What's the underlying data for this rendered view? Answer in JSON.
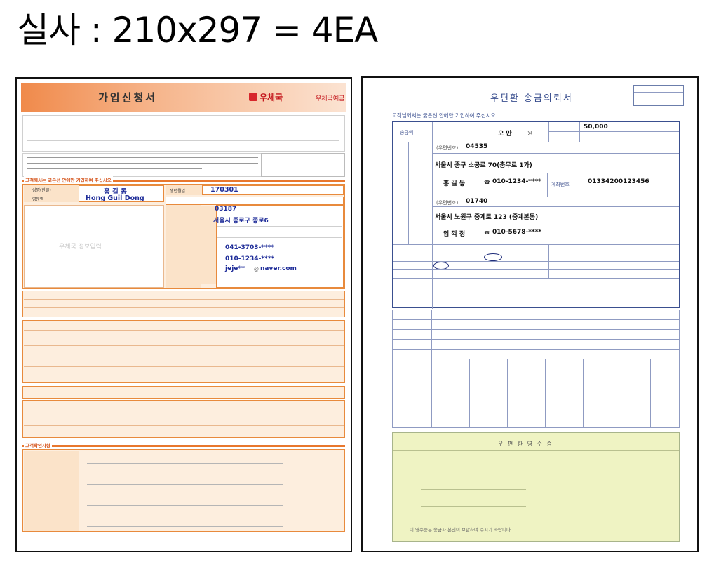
{
  "heading": "실사 : 210x297 = 4EA",
  "form1": {
    "title": "가입신청서",
    "brand": "우체국",
    "brand_sub": "우체국예금",
    "section_customer": "고객께서는 굵은선 안에만 기입하여 주십시오",
    "name_label": "성명(한글)",
    "name_en_label": "영문명",
    "name_ko": "홍 길 동",
    "name_en": "Hong Guil Dong",
    "birth_label": "생년월일",
    "birth": "170301",
    "zip": "03187",
    "address": "서울시 종로구 종로6",
    "phone_home": "041-3703-****",
    "phone_mobile": "010-1234-****",
    "email_id": "jeje**",
    "email_domain": "naver.com",
    "watermark": "우체국 정보입력",
    "section_confirm": "고객확인사항"
  },
  "form2": {
    "title": "우편환 송금의뢰서",
    "note": "고객님께서는 굵은선 안에만 기입하여 주십시오.",
    "amount_label": "송금액",
    "amount_name": "오 만",
    "amount_unit": "원",
    "amount_value": "50,000",
    "sender_zip_label": "(우편번호)",
    "sender_zip": "04535",
    "sender_addr": "서울시 중구 소공로 70(충무로 1가)",
    "sender_name": "홍 길 동",
    "sender_phone": "010-1234-****",
    "account_label": "계좌번호",
    "account": "01334200123456",
    "recv_zip": "01740",
    "recv_addr": "서울시 노원구 중계로 123 (중계본동)",
    "recv_name": "임 꺽 정",
    "recv_phone": "010-5678-****",
    "stamp_title": "우 편 환 영 수 증",
    "stamp_note": "이 영수증은 송금자 본인이 보관하여 주시기 바랍니다."
  }
}
